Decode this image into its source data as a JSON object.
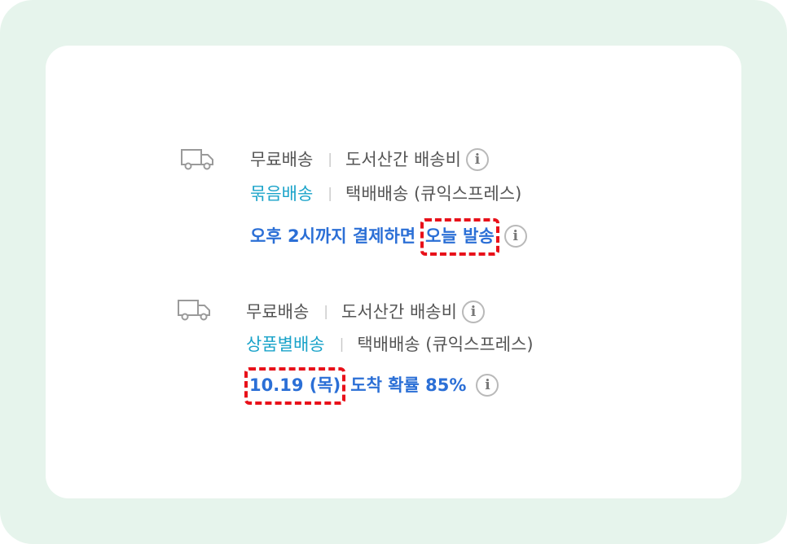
{
  "block1": {
    "icon": "truck-icon",
    "line1": {
      "shipping": "무료배송",
      "separator": "|",
      "extra_fee": "도서산간 배송비"
    },
    "line2": {
      "type": "묶음배송",
      "separator": "|",
      "carrier": "택배배송 (큐익스프레스)"
    },
    "line3": {
      "condition": "오후 2시까지 결제하면",
      "highlight": "오늘 발송"
    }
  },
  "block2": {
    "icon": "truck-icon",
    "line1": {
      "shipping": "무료배송",
      "separator": "|",
      "extra_fee": "도서산간 배송비"
    },
    "line2": {
      "type": "상품별배송",
      "separator": "|",
      "carrier": "택배배송 (큐익스프레스)"
    },
    "line3": {
      "highlight": "10.19 (목)",
      "arrival": "도착 확률 85%"
    }
  },
  "info_glyph": "i",
  "colors": {
    "frame_bg": "#e6f4ec",
    "card_bg": "#ffffff",
    "teal": "#1aa3c9",
    "blue": "#2b6fd6",
    "highlight_border": "#e8111a"
  }
}
